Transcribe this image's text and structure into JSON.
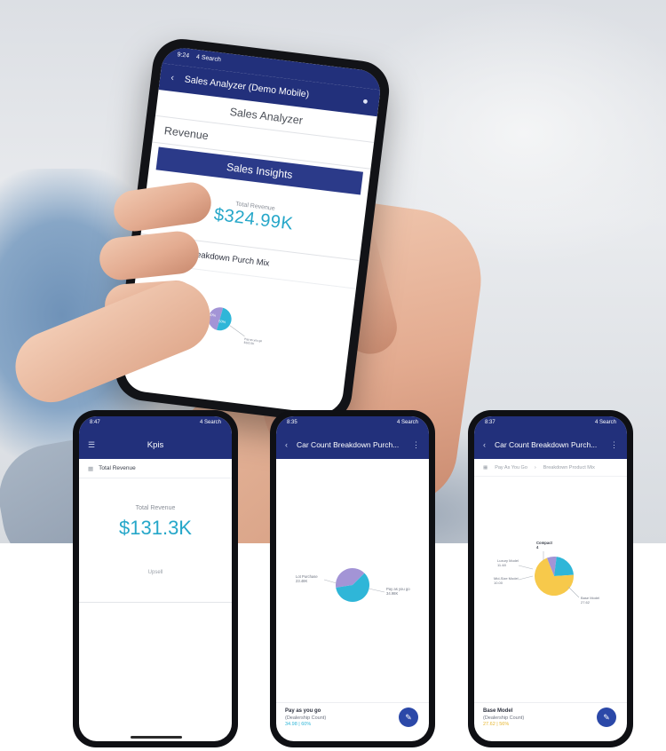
{
  "colors": {
    "app_bar": "#22307b",
    "insights_bar": "#2b3a89",
    "kpi_value": "#26a7c9",
    "pie_purple": "#a394d6",
    "pie_teal": "#2fb6d8",
    "pie_yellow": "#f7c94b",
    "fab": "#2b48a8"
  },
  "big_phone": {
    "status_time": "9:24",
    "status_carrier": "4 Search",
    "app_title": "Sales Analyzer (Demo Mobile)",
    "back_icon": "back-arrow-icon",
    "chat_icon": "chat-icon",
    "title_field": "Sales Analyzer",
    "measure_field": "Revenue",
    "insights_label": "Sales Insights",
    "kpi_label": "Total Revenue",
    "kpi_value": "$324.99K",
    "chart_title": "Revenue: Breakdown Purch Mix",
    "pie_label_left": "50%",
    "pie_label_right": "50%",
    "pie_callout": "Pay as you go\n$162.5K",
    "pie_values": [
      50,
      50
    ]
  },
  "phone_1": {
    "status_time": "8:47",
    "status_carrier": "4 Search",
    "app_title": "Kpis",
    "menu_icon": "menu-icon",
    "row_label": "Total Revenue",
    "kpi_label": "Total Revenue",
    "kpi_value": "$131.3K",
    "kpi_footer": "Upsell"
  },
  "phone_2": {
    "status_time": "8:35",
    "status_carrier": "4 Search",
    "app_title": "Car Count Breakdown Purch...",
    "back_icon": "back-arrow-icon",
    "more_icon": "more-vertical-icon",
    "pie_values": [
      40,
      60
    ],
    "pie_left_label": "Lot Purchase\n23.48K",
    "pie_right_label": "Pay as you go\n34.98K",
    "bottom_title": "Pay as you go",
    "bottom_subtitle": "(Dealership Count)",
    "bottom_value": "34.98 | 60%"
  },
  "phone_3": {
    "status_time": "8:37",
    "status_carrier": "4 Search",
    "app_title": "Car Count Breakdown Purch...",
    "back_icon": "back-arrow-icon",
    "more_icon": "more-vertical-icon",
    "breadcrumb_1": "Pay As You Go",
    "breadcrumb_2": "Breakdown Product Mix",
    "pie_values": [
      8,
      22,
      70
    ],
    "label_top": "Compact\n4",
    "label_left_1": "Luxury Model\n11.48",
    "label_left_2": "Mid-Size Model\n10.00",
    "label_right": "Base Model\n27.62",
    "bottom_title": "Base Model",
    "bottom_subtitle": "(Dealership Count)",
    "bottom_value": "27.62 | 56%"
  }
}
